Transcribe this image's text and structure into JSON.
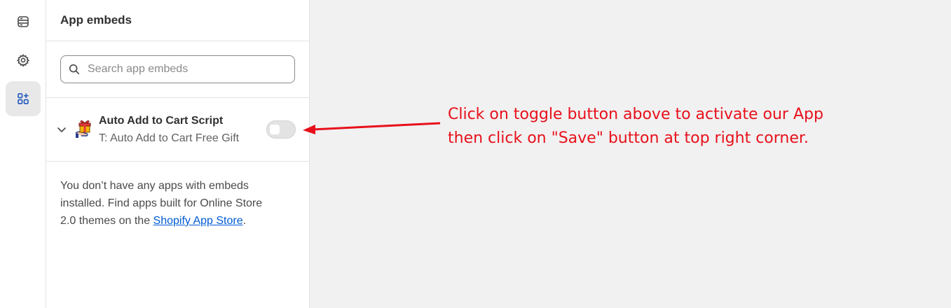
{
  "sidebar": {
    "items": [
      {
        "icon": "sections-icon",
        "active": false
      },
      {
        "icon": "gear-icon",
        "active": false
      },
      {
        "icon": "app-embeds-icon",
        "active": true
      }
    ]
  },
  "panel": {
    "title": "App embeds",
    "search": {
      "placeholder": "Search app embeds",
      "value": ""
    },
    "embeds": [
      {
        "name": "Auto Add to Cart Script",
        "subtitle": "T: Auto Add to Cart Free Gift",
        "enabled": false,
        "icon": "gift-icon"
      }
    ],
    "info_text": "You don’t have any apps with embeds installed. Find apps built for Online Store 2.0 themes on the ",
    "info_link": "Shopify App Store",
    "info_suffix": "."
  },
  "annotation": {
    "line1": "Click on toggle button above to activate our App",
    "line2": "then click on \"Save\" button at top right corner.",
    "color": "#e8101b"
  }
}
